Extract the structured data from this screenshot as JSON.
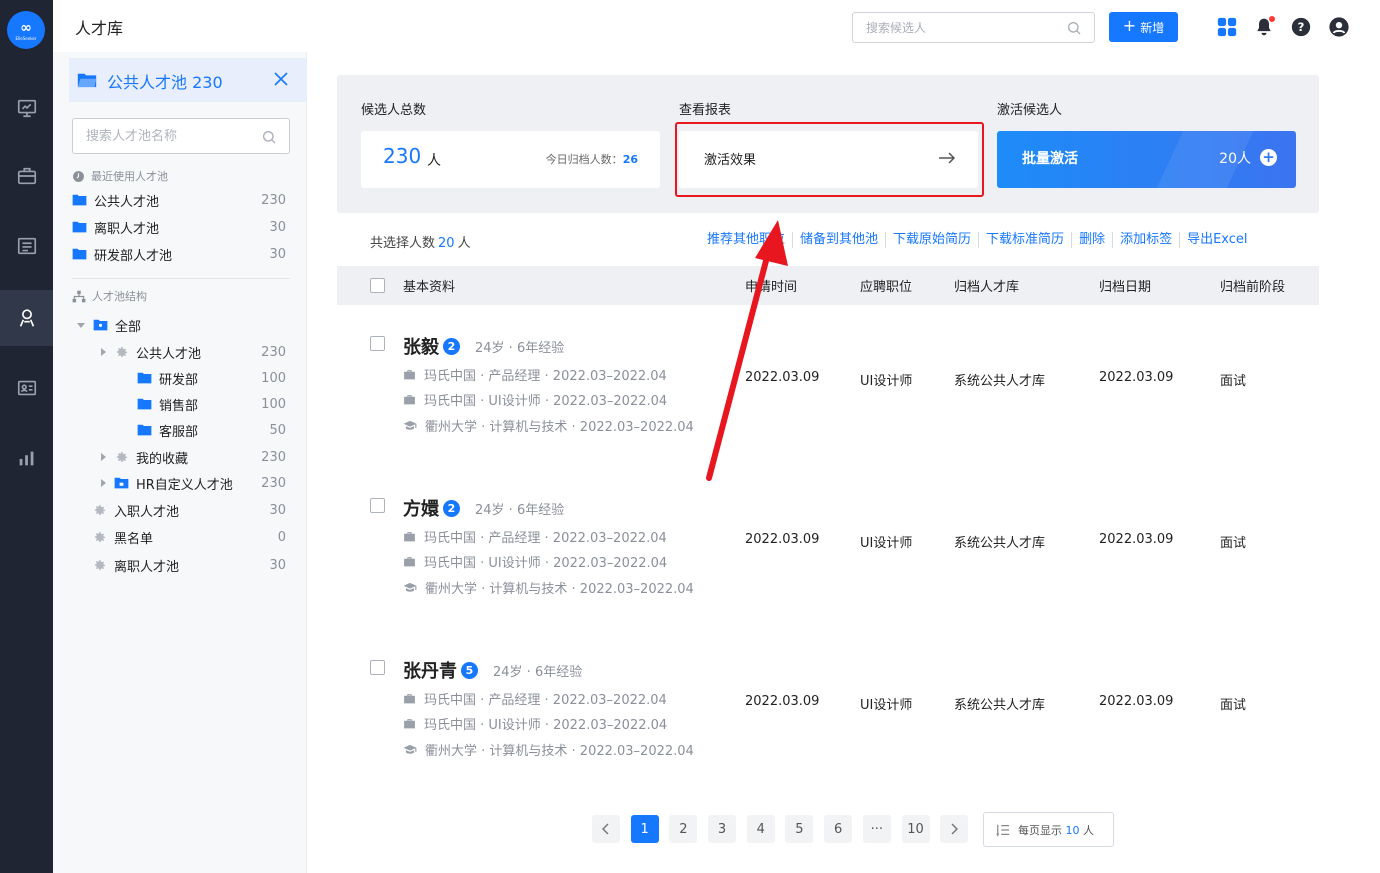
{
  "app": {
    "logo_text": "ElleSeeker",
    "page_title": "人才库"
  },
  "topbar": {
    "search_placeholder": "搜索候选人",
    "add_label": "新增"
  },
  "sidebar": {
    "pool_title": "公共人才池 230",
    "search_placeholder": "搜索人才池名称",
    "recent_title": "最近使用人才池",
    "recent": [
      {
        "label": "公共人才池",
        "count": "230"
      },
      {
        "label": "离职人才池",
        "count": "30"
      },
      {
        "label": "研发部人才池",
        "count": "30"
      }
    ],
    "structure_title": "人才池结构",
    "tree": [
      {
        "label": "全部",
        "count": ""
      },
      {
        "label": "公共人才池",
        "count": "230"
      },
      {
        "label": "研发部",
        "count": "100"
      },
      {
        "label": "销售部",
        "count": "100"
      },
      {
        "label": "客服部",
        "count": "50"
      },
      {
        "label": "我的收藏",
        "count": "230"
      },
      {
        "label": "HR自定义人才池",
        "count": "230"
      },
      {
        "label": "入职人才池",
        "count": "30"
      },
      {
        "label": "黑名单",
        "count": "0"
      },
      {
        "label": "离职人才池",
        "count": "30"
      }
    ]
  },
  "cards": {
    "total_title": "候选人总数",
    "total_value": "230",
    "total_unit": "人",
    "today_label": "今日归档人数：",
    "today_value": "26",
    "report_title": "查看报表",
    "report_label": "激活效果",
    "activate_title": "激活候选人",
    "activate_label": "批量激活",
    "activate_count": "20人"
  },
  "selection": {
    "prefix": "共选择人数",
    "count": "20",
    "suffix": "人"
  },
  "actions": [
    "推荐其他职位",
    "储备到其他池",
    "下载原始简历",
    "下载标准简历",
    "删除",
    "添加标签",
    "导出Excel"
  ],
  "table": {
    "headers": {
      "basic": "基本资料",
      "apply_time": "申请时间",
      "position": "应聘职位",
      "archive_pool": "归档人才库",
      "archive_date": "归档日期",
      "prev_stage": "归档前阶段"
    },
    "rows": [
      {
        "name": "张毅",
        "badge": "2",
        "meta": "24岁 · 6年经验",
        "lines": [
          "玛氏中国 · 产品经理 · 2022.03–2022.04",
          "玛氏中国 · UI设计师 · 2022.03–2022.04",
          "衢州大学 · 计算机与技术 · 2022.03–2022.04"
        ],
        "apply_time": "2022.03.09",
        "position": "UI设计师",
        "archive_pool": "系统公共人才库",
        "archive_date": "2022.03.09",
        "prev_stage": "面试"
      },
      {
        "name": "方嬛",
        "badge": "2",
        "meta": "24岁 · 6年经验",
        "lines": [
          "玛氏中国 · 产品经理 · 2022.03–2022.04",
          "玛氏中国 · UI设计师 · 2022.03–2022.04",
          "衢州大学 · 计算机与技术 · 2022.03–2022.04"
        ],
        "apply_time": "2022.03.09",
        "position": "UI设计师",
        "archive_pool": "系统公共人才库",
        "archive_date": "2022.03.09",
        "prev_stage": "面试"
      },
      {
        "name": "张丹青",
        "badge": "5",
        "meta": "24岁 · 6年经验",
        "lines": [
          "玛氏中国 · 产品经理 · 2022.03–2022.04",
          "玛氏中国 · UI设计师 · 2022.03–2022.04",
          "衢州大学 · 计算机与技术 · 2022.03–2022.04"
        ],
        "apply_time": "2022.03.09",
        "position": "UI设计师",
        "archive_pool": "系统公共人才库",
        "archive_date": "2022.03.09",
        "prev_stage": "面试"
      }
    ]
  },
  "pagination": {
    "pages": [
      "1",
      "2",
      "3",
      "4",
      "5",
      "6",
      "···",
      "10"
    ],
    "current": "1",
    "per_page_prefix": "每页显示",
    "per_page_value": "10",
    "per_page_suffix": "人"
  },
  "colors": {
    "accent": "#1677ff",
    "rail": "#1f2532",
    "highlight": "#e8171f"
  }
}
